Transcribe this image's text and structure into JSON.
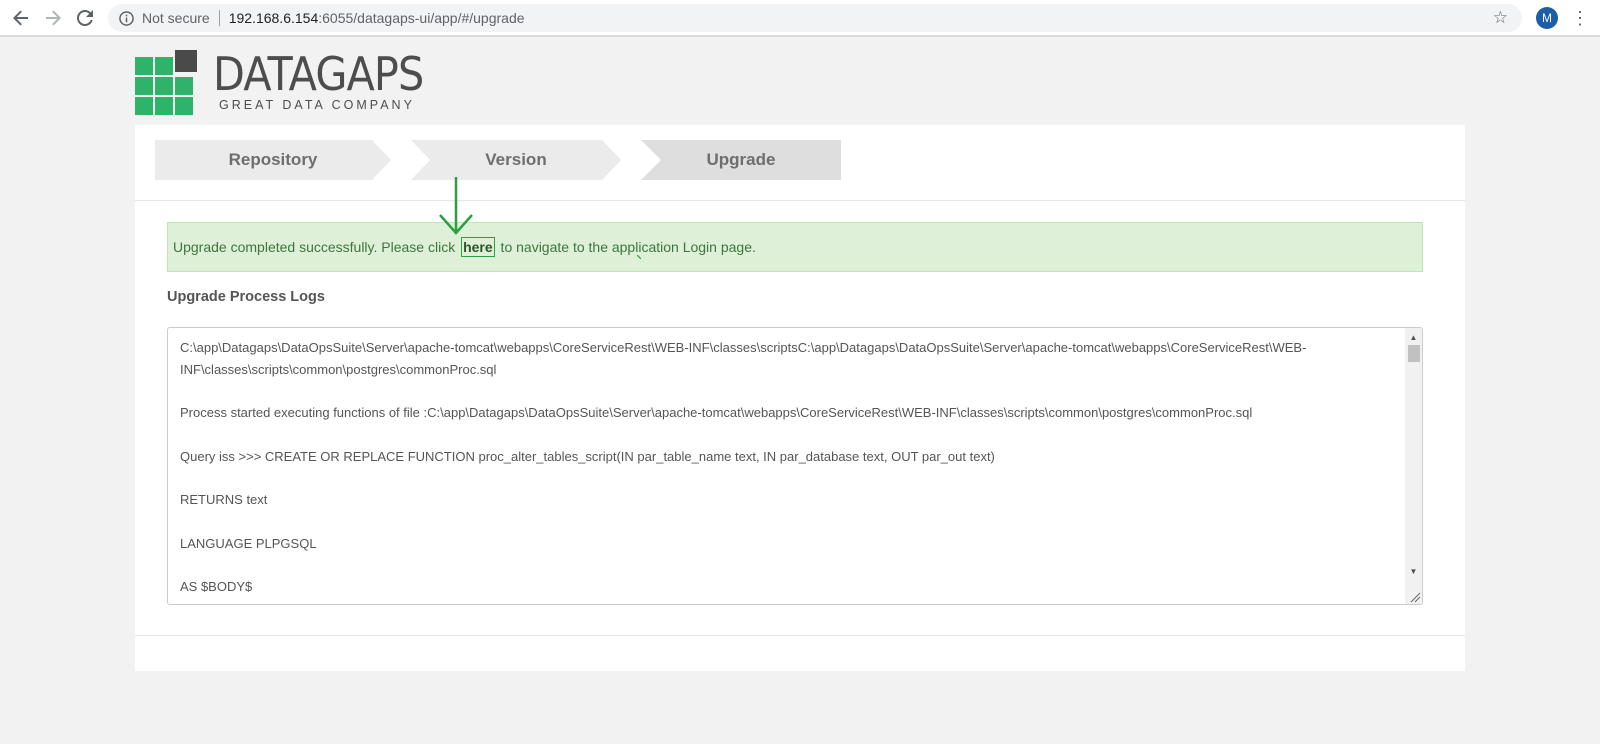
{
  "browser": {
    "security_label": "Not secure",
    "url_host": "192.168.6.154",
    "url_path": ":6055/datagaps-ui/app/#/upgrade",
    "profile_initial": "M",
    "icons": [
      "back-arrow-icon",
      "forward-arrow-icon",
      "reload-icon",
      "info-icon",
      "star-icon",
      "menu-dots-icon"
    ]
  },
  "logo": {
    "name": "DATAGAPS",
    "tagline": "GREAT  DATA COMPANY",
    "colors": {
      "green": "#2fb36b",
      "dark": "#4a4a4a",
      "text": "#4d4d4d"
    }
  },
  "wizard": {
    "steps": [
      {
        "label": "Repository"
      },
      {
        "label": "Version"
      },
      {
        "label": "Upgrade"
      }
    ],
    "active_step": 2
  },
  "alert": {
    "text_before": "Upgrade completed successfully. Please click ",
    "link_text": "here",
    "text_after": " to navigate to the application Login page.",
    "colors": {
      "background": "#dff0d8",
      "text": "#3c763d",
      "annotation": "#2ba040"
    }
  },
  "logs": {
    "title": "Upgrade Process Logs",
    "lines": [
      "C:\\app\\Datagaps\\DataOpsSuite\\Server\\apache-tomcat\\webapps\\CoreServiceRest\\WEB-INF\\classes\\scriptsC:\\app\\Datagaps\\DataOpsSuite\\Server\\apache-tomcat\\webapps\\CoreServiceRest\\WEB-INF\\classes\\scripts\\common\\postgres\\commonProc.sql",
      "Process started executing functions of file :C:\\app\\Datagaps\\DataOpsSuite\\Server\\apache-tomcat\\webapps\\CoreServiceRest\\WEB-INF\\classes\\scripts\\common\\postgres\\commonProc.sql",
      "Query iss >>> CREATE OR REPLACE FUNCTION proc_alter_tables_script(IN par_table_name text, IN par_database text, OUT par_out text)",
      "RETURNS text",
      "LANGUAGE PLPGSQL",
      "AS $BODY$"
    ]
  }
}
